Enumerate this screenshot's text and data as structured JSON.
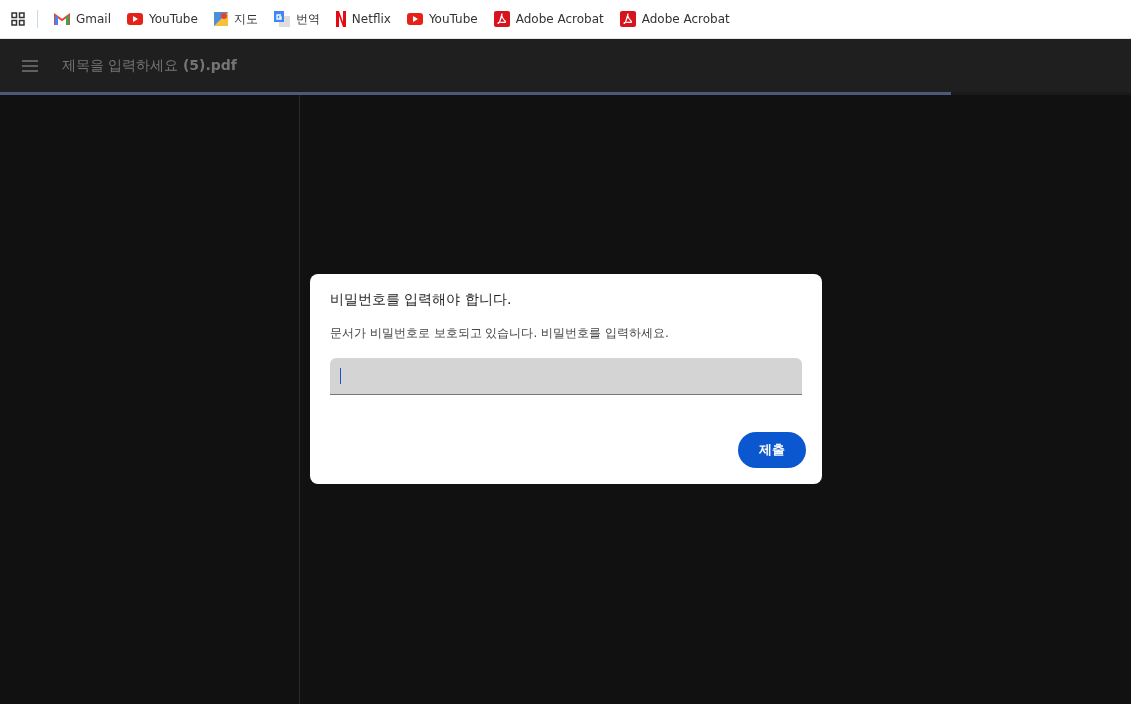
{
  "bookmarks": [
    {
      "kind": "gmail",
      "label": "Gmail"
    },
    {
      "kind": "youtube",
      "label": "YouTube"
    },
    {
      "kind": "maps",
      "label": "지도"
    },
    {
      "kind": "translate",
      "label": "번역"
    },
    {
      "kind": "netflix",
      "label": "Netflix"
    },
    {
      "kind": "youtube",
      "label": "YouTube"
    },
    {
      "kind": "acrobat",
      "label": "Adobe Acrobat"
    },
    {
      "kind": "acrobat",
      "label": "Adobe Acrobat"
    }
  ],
  "toolbar": {
    "title": "제목을 입력하세요 **(5).pdf**",
    "progress": {
      "level": 0.841
    }
  },
  "dialog": {
    "title": "비밀번호를 입력해야 합니다.",
    "message": "문서가 비밀번호로 보호되고 있습니다. 비밀번호를 입력하세요.",
    "submit": "제출"
  }
}
